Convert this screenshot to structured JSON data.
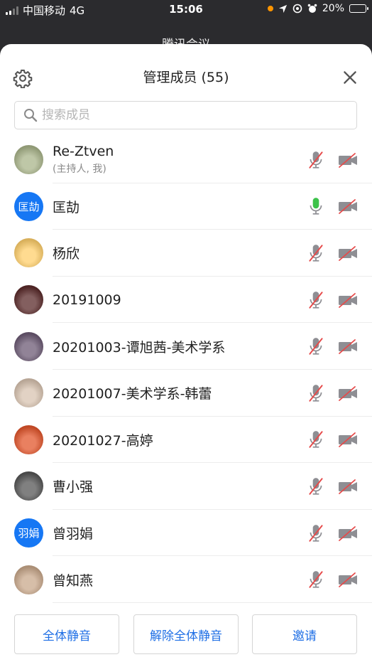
{
  "status_bar": {
    "carrier": "中国移动",
    "network": "4G",
    "time": "15:06",
    "battery": "20%"
  },
  "background_title": "腾讯会议",
  "header": {
    "title": "管理成员 (55)"
  },
  "search": {
    "placeholder": "搜索成员"
  },
  "members": [
    {
      "name": "Re-Ztven",
      "subtitle": "(主持人, 我)",
      "avatar_text": "",
      "avatar_color": "#a9b48a",
      "mic": "muted"
    },
    {
      "name": "匡劼",
      "subtitle": "",
      "avatar_text": "匡劼",
      "avatar_color": "#1677f4",
      "mic": "active"
    },
    {
      "name": " 杨欣",
      "subtitle": "",
      "avatar_text": "",
      "avatar_color": "#ffcf6b",
      "mic": "muted"
    },
    {
      "name": "20191009",
      "subtitle": "",
      "avatar_text": "",
      "avatar_color": "#5a2a2a",
      "mic": "muted"
    },
    {
      "name": "20201003-谭旭茜-美术学系",
      "subtitle": "",
      "avatar_text": "",
      "avatar_color": "#6c5a74",
      "mic": "muted"
    },
    {
      "name": "20201007-美术学系-韩蕾",
      "subtitle": "",
      "avatar_text": "",
      "avatar_color": "#d8c3b0",
      "mic": "muted"
    },
    {
      "name": "20201027-高婷",
      "subtitle": "",
      "avatar_text": "",
      "avatar_color": "#e2552b",
      "mic": "muted"
    },
    {
      "name": "曹小强",
      "subtitle": "",
      "avatar_text": "",
      "avatar_color": "#555555",
      "mic": "muted"
    },
    {
      "name": "曾羽娟",
      "subtitle": "",
      "avatar_text": "羽娟",
      "avatar_color": "#1677f4",
      "mic": "muted"
    },
    {
      "name": "曾知燕",
      "subtitle": "",
      "avatar_text": "",
      "avatar_color": "#c9a88b",
      "mic": "muted"
    }
  ],
  "footer": {
    "mute_all": "全体静音",
    "unmute_all": "解除全体静音",
    "invite": "邀请"
  },
  "colors": {
    "accent": "#1f6fe5",
    "muted_red": "#e64a4a",
    "mic_active": "#3cc24a",
    "icon_gray": "#8e8e93"
  }
}
